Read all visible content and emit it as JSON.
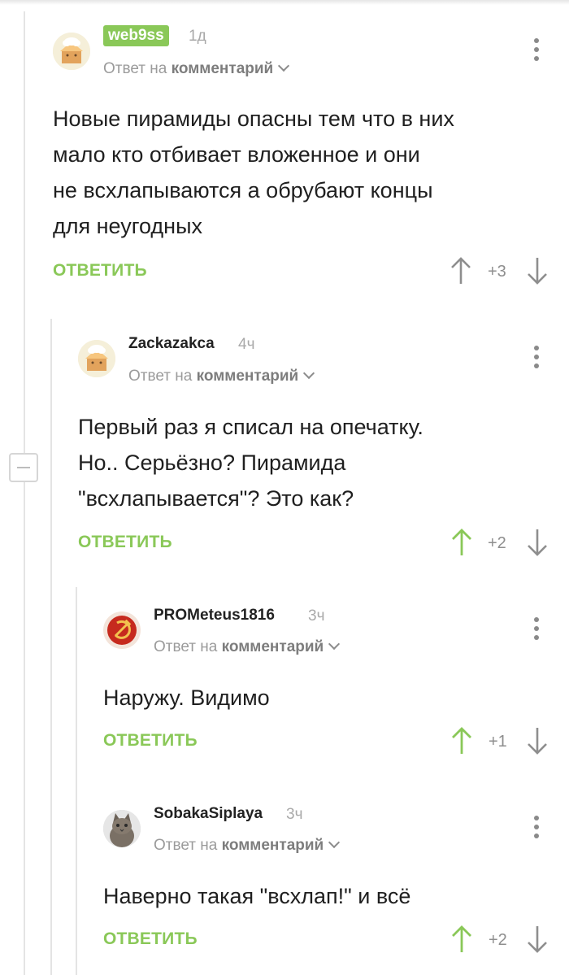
{
  "comments": [
    {
      "username": "web9ss",
      "time": "1д",
      "reply_prefix": "Ответ на",
      "reply_target": "комментарий",
      "text": "Новые пирамиды опасны тем что в них\nмало кто отбивает вложенное и они\nне всхлапываются а обрубают концы\nдля неугодных",
      "reply_label": "ОТВЕТИТЬ",
      "score": "+3",
      "avatar": "default-house-avatar"
    },
    {
      "username": "Zackazakca",
      "time": "4ч",
      "reply_prefix": "Ответ на",
      "reply_target": "комментарий",
      "text": "Первый раз я списал на опечатку.\nНо..  Серьёзно? Пирамида\n\"всхлапывается\"? Это как?",
      "reply_label": "ОТВЕТИТЬ",
      "score": "+2",
      "avatar": "default-house-avatar"
    },
    {
      "username": "PROMeteus1816",
      "time": "3ч",
      "reply_prefix": "Ответ на",
      "reply_target": "комментарий",
      "text": "Наружу. Видимо",
      "reply_label": "ОТВЕТИТЬ",
      "score": "+1",
      "avatar": "hammer-sickle-avatar"
    },
    {
      "username": "SobakaSiplaya",
      "time": "3ч",
      "reply_prefix": "Ответ на",
      "reply_target": "комментарий",
      "text": "Наверно такая \"всхлап!\" и всё",
      "reply_label": "ОТВЕТИТЬ",
      "score": "+2",
      "avatar": "cat-photo-avatar"
    }
  ],
  "colors": {
    "accent_green": "#8ac858",
    "upvoted_green": "#8ac858",
    "neutral_gray": "#8e8e8e"
  }
}
